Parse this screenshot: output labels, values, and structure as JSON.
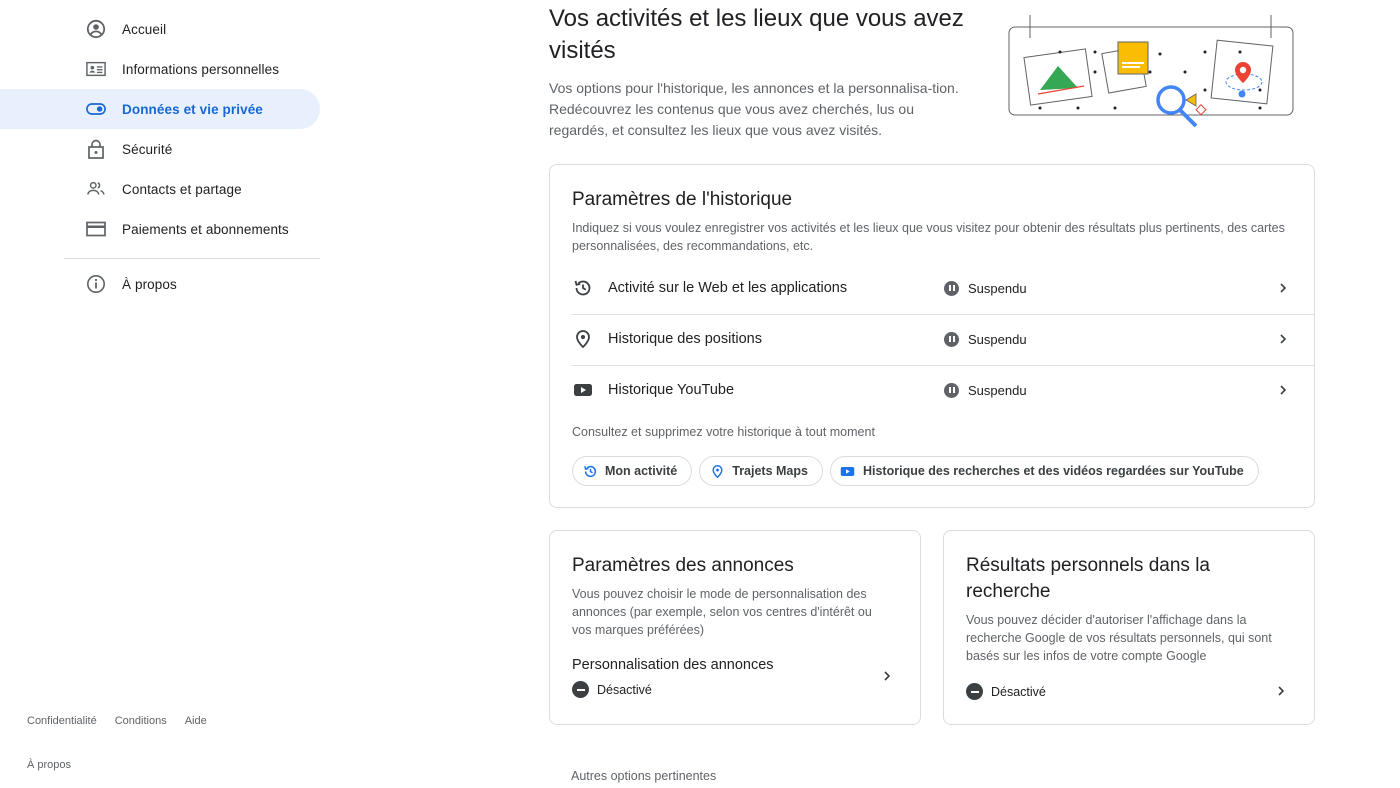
{
  "sidebar": {
    "items": [
      {
        "label": "Accueil",
        "icon": "account-circle-icon"
      },
      {
        "label": "Informations personnelles",
        "icon": "id-card-icon"
      },
      {
        "label": "Données et vie privée",
        "icon": "toggle-icon"
      },
      {
        "label": "Sécurité",
        "icon": "lock-icon"
      },
      {
        "label": "Contacts et partage",
        "icon": "people-icon"
      },
      {
        "label": "Paiements et abonnements",
        "icon": "credit-card-icon"
      }
    ],
    "about": {
      "label": "À propos",
      "icon": "info-icon"
    },
    "footer": {
      "privacy": "Confidentialité",
      "terms": "Conditions",
      "help": "Aide",
      "about": "À propos"
    }
  },
  "hero": {
    "title": "Vos activités et les lieux que vous avez visités",
    "description": "Vos options pour l'historique, les annonces et la personnalisa-tion. Redécouvrez les contenus que vous avez cherchés, lus ou regardés, et consultez les lieux que vous avez visités."
  },
  "history": {
    "title": "Paramètres de l'historique",
    "description": "Indiquez si vous voulez enregistrer vos activités et les lieux que vous visitez pour obtenir des résultats plus pertinents, des cartes personnalisées, des recommandations, etc.",
    "rows": [
      {
        "label": "Activité sur le Web et les applications",
        "status": "Suspendu",
        "icon": "history-icon"
      },
      {
        "label": "Historique des positions",
        "status": "Suspendu",
        "icon": "location-pin-icon"
      },
      {
        "label": "Historique YouTube",
        "status": "Suspendu",
        "icon": "youtube-icon"
      }
    ],
    "subtitle": "Consultez et supprimez votre historique à tout moment",
    "chips": [
      {
        "label": "Mon activité",
        "icon": "history-icon"
      },
      {
        "label": "Trajets Maps",
        "icon": "location-pin-icon"
      },
      {
        "label": "Historique des recherches et des vidéos regardées sur YouTube",
        "icon": "youtube-icon"
      }
    ]
  },
  "ads": {
    "title": "Paramètres des annonces",
    "description": "Vous pouvez choisir le mode de personnalisation des annonces (par exemple, selon vos centres d'intérêt ou vos marques préférées)",
    "setting_label": "Personnalisation des annonces",
    "status": "Désactivé"
  },
  "search": {
    "title": "Résultats personnels dans la recherche",
    "description": "Vous pouvez décider d'autoriser l'affichage dans la recherche Google de vos résultats personnels, qui sont basés sur les infos de votre compte Google",
    "status": "Désactivé"
  },
  "more_options": "Autres options pertinentes",
  "colors": {
    "accent": "#1967d2",
    "active_bg": "#e8f0fe",
    "border": "#dadce0",
    "text_secondary": "#5f6368"
  }
}
